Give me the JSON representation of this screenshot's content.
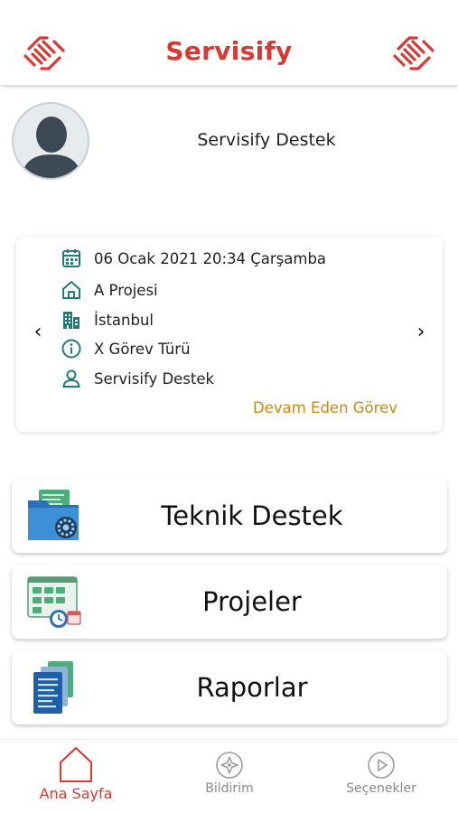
{
  "header": {
    "title": "Servisify"
  },
  "profile": {
    "name": "Servisify Destek"
  },
  "task": {
    "datetime": "06 Ocak 2021 20:34 Çarşamba",
    "project": "A Projesi",
    "city": "İstanbul",
    "task_type": "X Görev Türü",
    "assignee": "Servisify Destek",
    "status": "Devam Eden Görev",
    "prev_arrow": "‹",
    "next_arrow": "›"
  },
  "menu": [
    {
      "label": "Teknik Destek",
      "icon": "settings-folder-icon"
    },
    {
      "label": "Projeler",
      "icon": "project-board-icon"
    },
    {
      "label": "Raporlar",
      "icon": "report-documents-icon"
    }
  ],
  "bottom_nav": [
    {
      "label": "Ana Sayfa",
      "icon": "home-icon",
      "active": true
    },
    {
      "label": "Bildirim",
      "icon": "compass-icon",
      "active": false
    },
    {
      "label": "Seçenekler",
      "icon": "play-circle-icon",
      "active": false
    }
  ],
  "colors": {
    "brand": "#d63a34",
    "teal": "#1f7c78",
    "status": "#c98a16"
  }
}
